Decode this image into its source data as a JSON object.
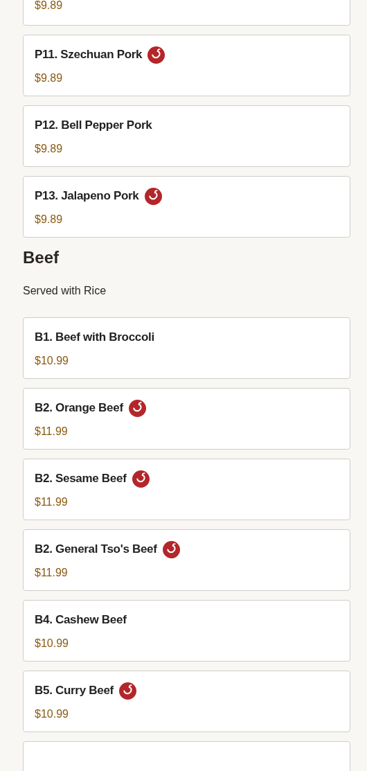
{
  "sections": [
    {
      "items": [
        {
          "price": "$9.89"
        },
        {
          "name": "P11. Szechuan Pork",
          "price": "$9.89",
          "spicy": true
        },
        {
          "name": "P12. Bell Pepper Pork",
          "price": "$9.89",
          "spicy": false
        },
        {
          "name": "P13. Jalapeno Pork",
          "price": "$9.89",
          "spicy": true
        }
      ]
    },
    {
      "title": "Beef",
      "subtitle": "Served with Rice",
      "items": [
        {
          "name": "B1. Beef with Broccoli",
          "price": "$10.99",
          "spicy": false
        },
        {
          "name": "B2. Orange Beef",
          "price": "$11.99",
          "spicy": true
        },
        {
          "name": "B2. Sesame Beef",
          "price": "$11.99",
          "spicy": true
        },
        {
          "name": "B2. General Tso's Beef",
          "price": "$11.99",
          "spicy": true
        },
        {
          "name": "B4. Cashew Beef",
          "price": "$10.99",
          "spicy": false
        },
        {
          "name": "B5. Curry Beef",
          "price": "$10.99",
          "spicy": true
        }
      ]
    }
  ]
}
